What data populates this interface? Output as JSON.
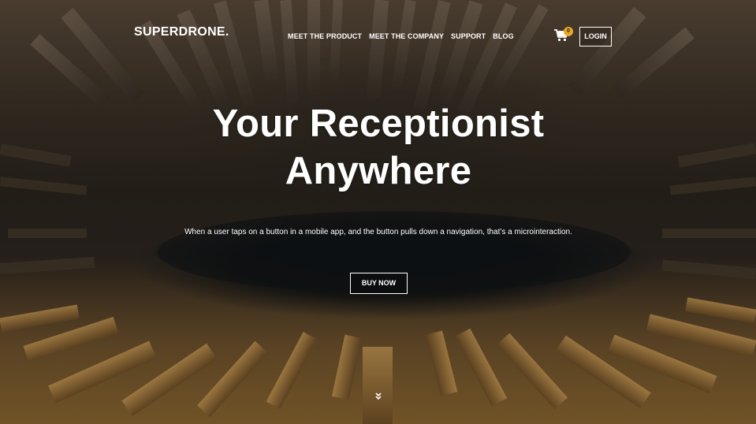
{
  "brand": {
    "logo": "SUPERDRONE."
  },
  "nav": {
    "items": [
      {
        "label": "MEET THE PRODUCT"
      },
      {
        "label": "MEET THE COMPANY"
      },
      {
        "label": "SUPPORT"
      },
      {
        "label": "BLOG"
      }
    ]
  },
  "header_actions": {
    "cart_icon": "cart-icon",
    "cart_count": "0",
    "login_label": "LOGIN"
  },
  "hero": {
    "headline_line1": "Your Receptionist",
    "headline_line2": "Anywhere",
    "subtitle": "When a user taps on a button in a mobile app, and the button pulls down a navigation, that’s a microinteraction.",
    "cta_label": "BUY NOW",
    "scroll_icon": "double-chevron-down-icon"
  },
  "colors": {
    "accent": "#e8a92a",
    "text": "#ffffff"
  }
}
